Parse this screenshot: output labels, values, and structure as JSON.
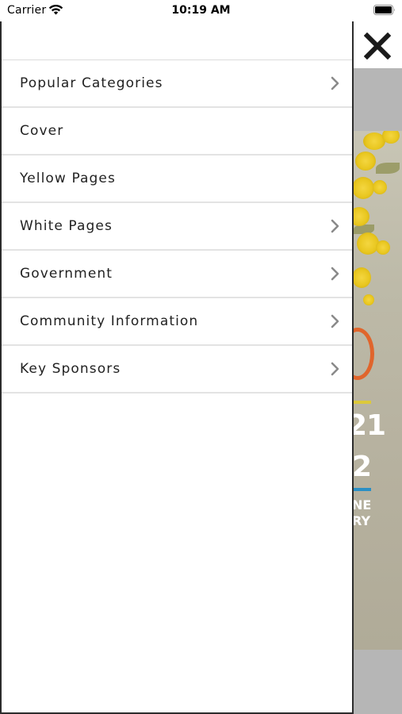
{
  "status_bar": {
    "carrier": "Carrier",
    "time": "10:19 AM",
    "icons": [
      "wifi-icon",
      "battery-icon"
    ]
  },
  "background": {
    "close_icon": "close-icon",
    "cover_text": {
      "line1": "21",
      "line2": "2",
      "line3": "NE",
      "line4": "RY"
    }
  },
  "menu": {
    "items": [
      {
        "label": "Popular Categories",
        "has_chevron": true
      },
      {
        "label": "Cover",
        "has_chevron": false
      },
      {
        "label": "Yellow Pages",
        "has_chevron": false
      },
      {
        "label": "White Pages",
        "has_chevron": true
      },
      {
        "label": "Government",
        "has_chevron": true
      },
      {
        "label": "Community Information",
        "has_chevron": true
      },
      {
        "label": "Key Sponsors",
        "has_chevron": true
      }
    ]
  },
  "colors": {
    "drawer_border": "#2c2c2c",
    "divider": "#e3e3e3",
    "chevron": "#8a8a8a",
    "background_gray": "#b6b6b6",
    "accent_orange": "#e0652c",
    "accent_blue": "#2a8fc4",
    "accent_yellow": "#dcc93a"
  }
}
